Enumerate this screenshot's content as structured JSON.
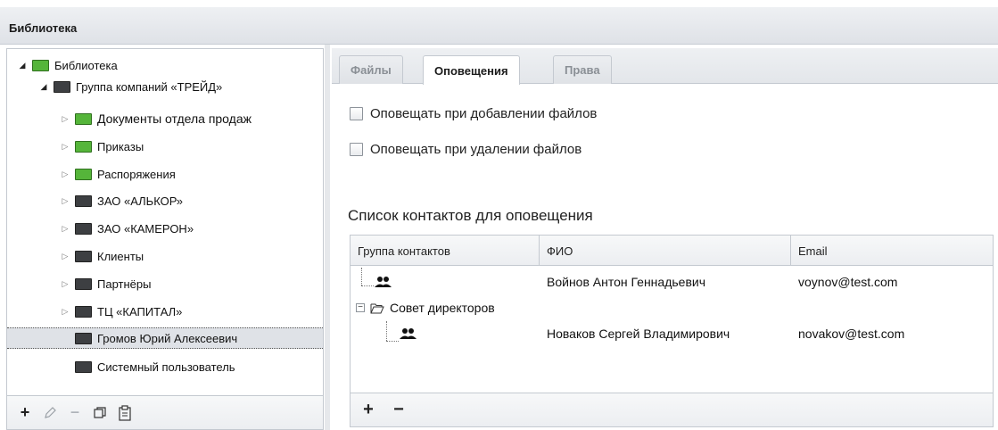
{
  "app": {
    "title": "Библиотека"
  },
  "tree": {
    "items": [
      {
        "label": "Библиотека",
        "color": "green",
        "expanded": true
      },
      {
        "label": "Группа компаний «ТРЕЙД»",
        "color": "dark",
        "expanded": true
      },
      {
        "label": "Документы отдела продаж",
        "color": "green",
        "expanded": false
      },
      {
        "label": "Приказы",
        "color": "green",
        "expanded": false
      },
      {
        "label": "Распоряжения",
        "color": "green",
        "expanded": false
      },
      {
        "label": "ЗАО «АЛЬКОР»",
        "color": "dark",
        "expanded": false
      },
      {
        "label": "ЗАО «КАМЕРОН»",
        "color": "dark",
        "expanded": false
      },
      {
        "label": "Клиенты",
        "color": "dark",
        "expanded": false
      },
      {
        "label": "Партнёры",
        "color": "dark",
        "expanded": false
      },
      {
        "label": "ТЦ «КАПИТАЛ»",
        "color": "dark",
        "expanded": false
      },
      {
        "label": "Громов Юрий Алексеевич",
        "color": "dark",
        "selected": true
      },
      {
        "label": "Системный пользователь",
        "color": "dark"
      }
    ],
    "toolbar": {
      "add": "+",
      "edit": "✎",
      "remove": "−",
      "copy": "⧉",
      "paste": "📋"
    }
  },
  "tabs": [
    {
      "label": "Файлы",
      "active": false
    },
    {
      "label": "Оповещения",
      "active": true
    },
    {
      "label": "Права",
      "active": false
    }
  ],
  "notifications": {
    "on_add_label": "Оповещать при добавлении файлов",
    "on_delete_label": "Оповещать при удалении файлов",
    "contacts_title": "Список контактов для оповещения"
  },
  "contacts_grid": {
    "columns": [
      "Группа контактов",
      "ФИО",
      "Email"
    ],
    "rows": [
      {
        "group": "",
        "name": "Войнов Антон Геннадьевич",
        "email": "voynov@test.com"
      },
      {
        "group": "Совет директоров",
        "name": "",
        "email": ""
      },
      {
        "group": "",
        "name": "Новаков Сергей Владимирович",
        "email": "novakov@test.com"
      }
    ],
    "toolbar": {
      "add": "+",
      "remove": "−"
    }
  },
  "colors": {
    "folder_green": "#55b53a",
    "folder_dark": "#3d3f42",
    "selected_row": "#dfe2e7"
  }
}
